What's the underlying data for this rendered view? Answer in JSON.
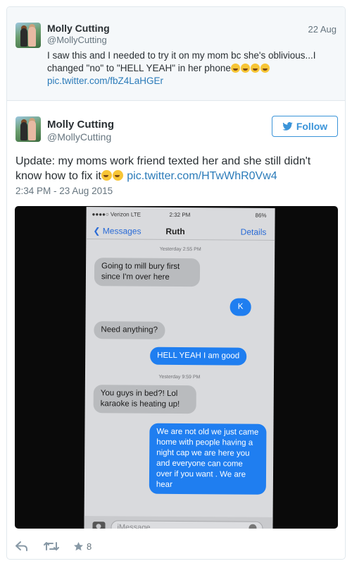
{
  "quoted": {
    "name": "Molly Cutting",
    "handle": "@MollyCutting",
    "date": "22 Aug",
    "text_pre": "I saw this and I needed to try it on my mom bc she's oblivious...I changed \"no\" to \"HELL YEAH\" in her phone",
    "link": "pic.twitter.com/fbZ4LaHGEr"
  },
  "tweet": {
    "name": "Molly Cutting",
    "handle": "@MollyCutting",
    "follow_label": "Follow",
    "text_pre": "Update: my moms work friend texted her and she still didn't know how to fix it",
    "link": "pic.twitter.com/HTwWhR0Vw4",
    "timestamp": "2:34 PM - 23 Aug 2015",
    "fav_count": "8"
  },
  "photo": {
    "carrier": "●●●●○ Verizon  LTE",
    "time": "2:32 PM",
    "battery": "86%",
    "back_label": "Messages",
    "contact": "Ruth",
    "details_label": "Details",
    "stamp1": "Yesterday 2:55 PM",
    "stamp2": "Yesterday 9:59 PM",
    "messages": [
      {
        "dir": "in",
        "text": "Going to mill bury first since I'm over here"
      },
      {
        "dir": "out",
        "text": "K"
      },
      {
        "dir": "in",
        "text": "Need anything?"
      },
      {
        "dir": "out",
        "text": "HELL YEAH I am good"
      },
      {
        "dir": "in",
        "text": "You guys in bed?! Lol karaoke is heating up!"
      },
      {
        "dir": "out",
        "text": "We are not old we just came home with people having a night cap we are here you and everyone can come over if you want . We are hear"
      }
    ],
    "input_placeholder": "iMessage"
  },
  "colors": {
    "link": "#2b7bb9",
    "follow": "#3b94d9",
    "sent_bubble": "#1f7ef0",
    "received_bubble": "#b9bbbe"
  },
  "icons": [
    "reply-icon",
    "retweet-icon",
    "star-icon",
    "twitter-bird-icon",
    "camera-icon",
    "microphone-icon"
  ]
}
